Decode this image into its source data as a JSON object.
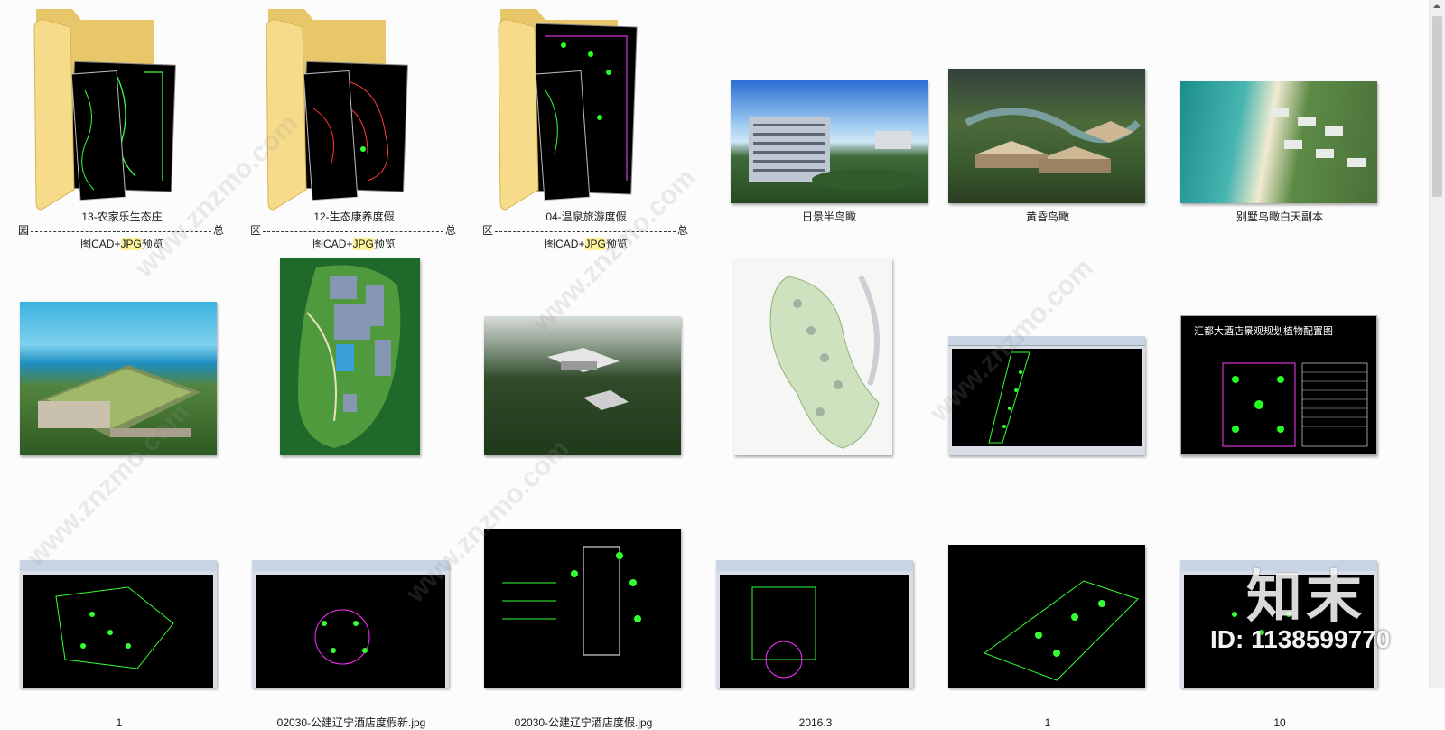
{
  "items": [
    {
      "name": "13-农家乐生态庄",
      "line2": "图CAD+JPG预览",
      "left": "园",
      "right": "总"
    },
    {
      "name": "12-生态康养度假",
      "line2": "图CAD+JPG预览",
      "left": "区",
      "right": "总"
    },
    {
      "name": "04-温泉旅游度假",
      "line2": "图CAD+JPG预览",
      "left": "区",
      "right": "总"
    },
    {
      "name": "日景半鸟瞰"
    },
    {
      "name": "黄昏鸟瞰"
    },
    {
      "name": "别墅鸟瞰白天副本"
    },
    {
      "name": "1"
    },
    {
      "name": "02030-公建辽宁酒店度假新.jpg"
    },
    {
      "name": "02030-公建辽宁酒店度假.jpg"
    },
    {
      "name": "2016.3"
    },
    {
      "name": "1"
    },
    {
      "name": "10"
    }
  ],
  "highlight_term": "JPG",
  "plan_title": "汇都大酒店景观规划植物配置图",
  "watermark": {
    "brand": "知末",
    "id": "ID: 1138599770",
    "site": "www.znzmo.com"
  },
  "colors": {
    "highlight": "#fff39a",
    "cad_bg": "#000000",
    "cad_green": "#22ff33"
  }
}
